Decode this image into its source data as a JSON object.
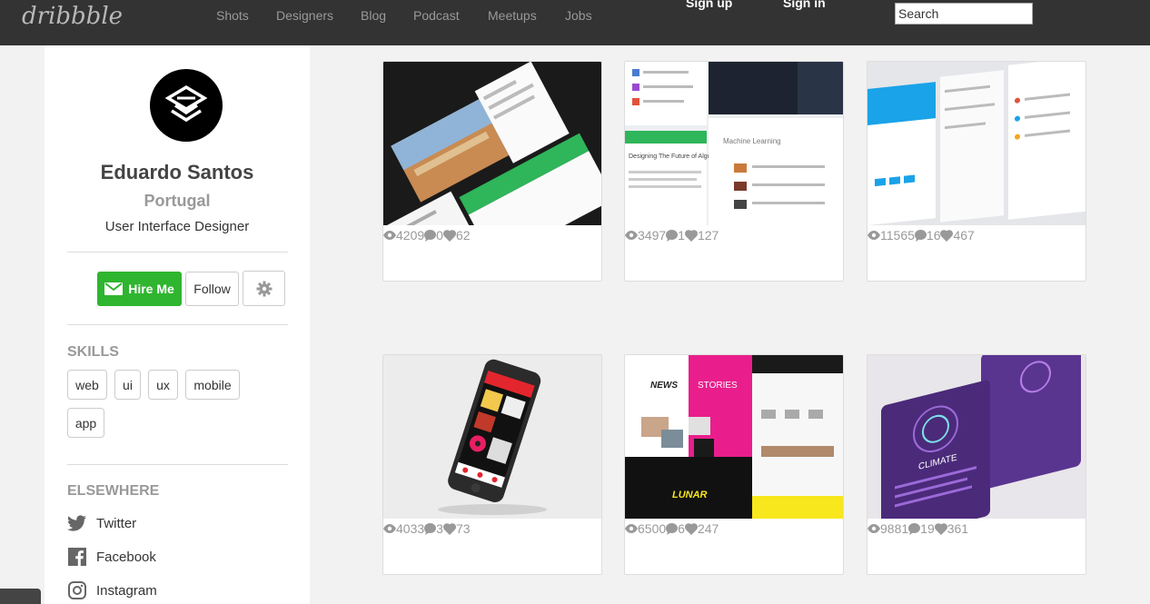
{
  "header": {
    "logo": "dribbble",
    "nav": [
      "Shots",
      "Designers",
      "Blog",
      "Podcast",
      "Meetups",
      "Jobs"
    ],
    "sign_up": "Sign up",
    "sign_in": "Sign in",
    "search_placeholder": "Search"
  },
  "profile": {
    "name": "Eduardo Santos",
    "location": "Portugal",
    "title": "User Interface Designer",
    "hire_label": "Hire Me",
    "follow_label": "Follow"
  },
  "skills": {
    "heading": "SKILLS",
    "tags": [
      "web",
      "ui",
      "ux",
      "mobile",
      "app"
    ]
  },
  "elsewhere": {
    "heading": "ELSEWHERE",
    "links": [
      {
        "label": "Twitter",
        "icon": "twitter-icon"
      },
      {
        "label": "Facebook",
        "icon": "facebook-icon"
      },
      {
        "label": "Instagram",
        "icon": "instagram-icon"
      }
    ]
  },
  "shots": [
    {
      "views": "4209",
      "comments": "0",
      "likes": "62"
    },
    {
      "views": "3497",
      "comments": "1",
      "likes": "127"
    },
    {
      "views": "11565",
      "comments": "16",
      "likes": "467"
    },
    {
      "views": "4033",
      "comments": "3",
      "likes": "73"
    },
    {
      "views": "6500",
      "comments": "6",
      "likes": "247"
    },
    {
      "views": "9881",
      "comments": "19",
      "likes": "361"
    }
  ],
  "shot_thumbs": {
    "news": "NEWS",
    "stories": "STORIES",
    "lunar": "LUNAR",
    "climate": "CLIMATE",
    "algorithms": "Designing The Future of Algorithms",
    "machine_learning": "Machine Learning"
  },
  "colors": {
    "topbar": "#333333",
    "hire_green": "#2fb52f",
    "accent_pink": "#e91e8c",
    "accent_yellow": "#f8e71c",
    "climate_purple": "#4b2a7a"
  }
}
